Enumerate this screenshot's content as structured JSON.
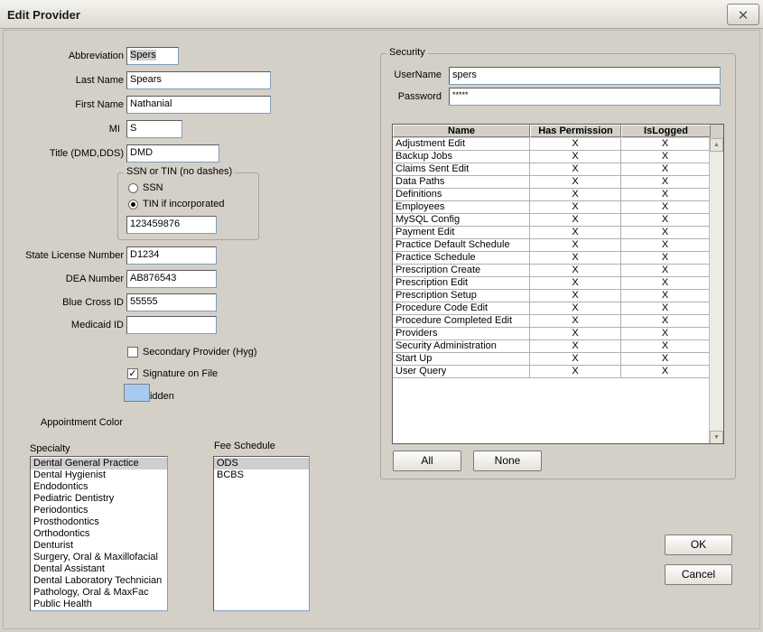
{
  "window": {
    "title": "Edit Provider",
    "close_glyph": "✕"
  },
  "form": {
    "abbreviation": {
      "label": "Abbreviation",
      "value": "Spers"
    },
    "last_name": {
      "label": "Last Name",
      "value": "Spears"
    },
    "first_name": {
      "label": "First Name",
      "value": "Nathanial"
    },
    "mi": {
      "label": "MI",
      "value": "S"
    },
    "title": {
      "label": "Title (DMD,DDS)",
      "value": "DMD"
    },
    "ssn_group": {
      "caption": "SSN or TIN (no dashes)",
      "ssn_label": "SSN",
      "tin_label": "TIN if incorporated",
      "selected": "TIN",
      "value": "123459876"
    },
    "state_license": {
      "label": "State License Number",
      "value": "D1234"
    },
    "dea": {
      "label": "DEA Number",
      "value": "AB876543"
    },
    "blue_cross": {
      "label": "Blue Cross ID",
      "value": "55555"
    },
    "medicaid": {
      "label": "Medicaid ID",
      "value": ""
    },
    "secondary_provider": {
      "label": "Secondary Provider (Hyg)",
      "checked": false
    },
    "signature_on_file": {
      "label": "Signature on File",
      "checked": true
    },
    "hidden": {
      "label": "Hidden",
      "checked": false
    },
    "appointment_color": {
      "label": "Appointment Color",
      "color": "#a6caf0"
    }
  },
  "specialty": {
    "label": "Specialty",
    "selected": "Dental General Practice",
    "items": [
      "Dental General Practice",
      "Dental Hygienist",
      "Endodontics",
      "Pediatric Dentistry",
      "Periodontics",
      "Prosthodontics",
      "Orthodontics",
      "Denturist",
      "Surgery, Oral & Maxillofacial",
      "Dental Assistant",
      "Dental Laboratory Technician",
      "Pathology, Oral & MaxFac",
      "Public Health"
    ]
  },
  "fee_schedule": {
    "label": "Fee Schedule",
    "selected": "ODS",
    "items": [
      "ODS",
      "BCBS"
    ]
  },
  "security": {
    "caption": "Security",
    "username_label": "UserName",
    "username": "spers",
    "password_label": "Password",
    "password": "*****",
    "columns": [
      "Name",
      "Has Permission",
      "IsLogged"
    ],
    "rows": [
      {
        "name": "Adjustment Edit",
        "perm": "X",
        "logged": "X"
      },
      {
        "name": "Backup Jobs",
        "perm": "X",
        "logged": "X"
      },
      {
        "name": "Claims Sent Edit",
        "perm": "X",
        "logged": "X"
      },
      {
        "name": "Data Paths",
        "perm": "X",
        "logged": "X"
      },
      {
        "name": "Definitions",
        "perm": "X",
        "logged": "X"
      },
      {
        "name": "Employees",
        "perm": "X",
        "logged": "X"
      },
      {
        "name": "MySQL Config",
        "perm": "X",
        "logged": "X"
      },
      {
        "name": "Payment Edit",
        "perm": "X",
        "logged": "X"
      },
      {
        "name": "Practice Default Schedule",
        "perm": "X",
        "logged": "X"
      },
      {
        "name": "Practice Schedule",
        "perm": "X",
        "logged": "X"
      },
      {
        "name": "Prescription Create",
        "perm": "X",
        "logged": "X"
      },
      {
        "name": "Prescription Edit",
        "perm": "X",
        "logged": "X"
      },
      {
        "name": "Prescription Setup",
        "perm": "X",
        "logged": "X"
      },
      {
        "name": "Procedure Code Edit",
        "perm": "X",
        "logged": "X"
      },
      {
        "name": "Procedure Completed Edit",
        "perm": "X",
        "logged": "X"
      },
      {
        "name": "Providers",
        "perm": "X",
        "logged": "X"
      },
      {
        "name": "Security Administration",
        "perm": "X",
        "logged": "X"
      },
      {
        "name": "Start Up",
        "perm": "X",
        "logged": "X"
      },
      {
        "name": "User Query",
        "perm": "X",
        "logged": "X"
      }
    ],
    "scroll_up_glyph": "▲",
    "scroll_down_glyph": "▼",
    "all_label": "All",
    "none_label": "None"
  },
  "buttons": {
    "ok": "OK",
    "cancel": "Cancel"
  }
}
